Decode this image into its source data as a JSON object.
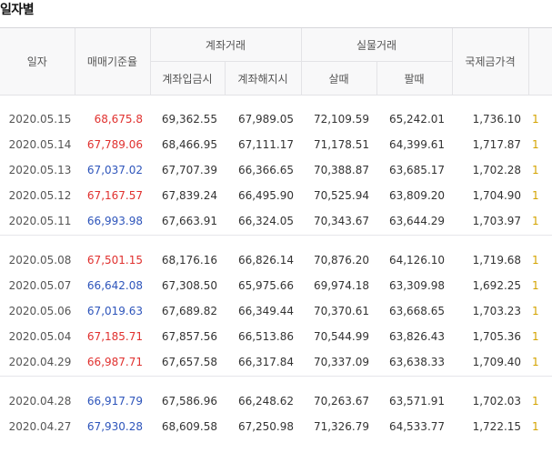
{
  "section": {
    "title": "일자별"
  },
  "header": {
    "date": "일자",
    "base_rate": "매매기준율",
    "account_group": "계좌거래",
    "account_deposit": "계좌입금시",
    "account_withdraw": "계좌해지시",
    "physical_group": "실물거래",
    "physical_buy": "살때",
    "physical_sell": "팔때",
    "intl_price": "국제금가격"
  },
  "colors": {
    "up": "#e0312f",
    "down": "#2e55bb",
    "extra": "#d4a300"
  },
  "groups": [
    {
      "rows": [
        {
          "date": "2020.05.15",
          "base": "68,675.8",
          "trend": "up",
          "deposit": "69,362.55",
          "withdraw": "67,989.05",
          "buy": "72,109.59",
          "sell": "65,242.01",
          "intl": "1,736.10",
          "extra": "1"
        },
        {
          "date": "2020.05.14",
          "base": "67,789.06",
          "trend": "up",
          "deposit": "68,466.95",
          "withdraw": "67,111.17",
          "buy": "71,178.51",
          "sell": "64,399.61",
          "intl": "1,717.87",
          "extra": "1"
        },
        {
          "date": "2020.05.13",
          "base": "67,037.02",
          "trend": "down",
          "deposit": "67,707.39",
          "withdraw": "66,366.65",
          "buy": "70,388.87",
          "sell": "63,685.17",
          "intl": "1,702.28",
          "extra": "1"
        },
        {
          "date": "2020.05.12",
          "base": "67,167.57",
          "trend": "up",
          "deposit": "67,839.24",
          "withdraw": "66,495.90",
          "buy": "70,525.94",
          "sell": "63,809.20",
          "intl": "1,704.90",
          "extra": "1"
        },
        {
          "date": "2020.05.11",
          "base": "66,993.98",
          "trend": "down",
          "deposit": "67,663.91",
          "withdraw": "66,324.05",
          "buy": "70,343.67",
          "sell": "63,644.29",
          "intl": "1,703.97",
          "extra": "1"
        }
      ]
    },
    {
      "rows": [
        {
          "date": "2020.05.08",
          "base": "67,501.15",
          "trend": "up",
          "deposit": "68,176.16",
          "withdraw": "66,826.14",
          "buy": "70,876.20",
          "sell": "64,126.10",
          "intl": "1,719.68",
          "extra": "1"
        },
        {
          "date": "2020.05.07",
          "base": "66,642.08",
          "trend": "down",
          "deposit": "67,308.50",
          "withdraw": "65,975.66",
          "buy": "69,974.18",
          "sell": "63,309.98",
          "intl": "1,692.25",
          "extra": "1"
        },
        {
          "date": "2020.05.06",
          "base": "67,019.63",
          "trend": "down",
          "deposit": "67,689.82",
          "withdraw": "66,349.44",
          "buy": "70,370.61",
          "sell": "63,668.65",
          "intl": "1,703.23",
          "extra": "1"
        },
        {
          "date": "2020.05.04",
          "base": "67,185.71",
          "trend": "up",
          "deposit": "67,857.56",
          "withdraw": "66,513.86",
          "buy": "70,544.99",
          "sell": "63,826.43",
          "intl": "1,705.36",
          "extra": "1"
        },
        {
          "date": "2020.04.29",
          "base": "66,987.71",
          "trend": "up",
          "deposit": "67,657.58",
          "withdraw": "66,317.84",
          "buy": "70,337.09",
          "sell": "63,638.33",
          "intl": "1,709.40",
          "extra": "1"
        }
      ]
    },
    {
      "rows": [
        {
          "date": "2020.04.28",
          "base": "66,917.79",
          "trend": "down",
          "deposit": "67,586.96",
          "withdraw": "66,248.62",
          "buy": "70,263.67",
          "sell": "63,571.91",
          "intl": "1,702.03",
          "extra": "1"
        },
        {
          "date": "2020.04.27",
          "base": "67,930.28",
          "trend": "down",
          "deposit": "68,609.58",
          "withdraw": "67,250.98",
          "buy": "71,326.79",
          "sell": "64,533.77",
          "intl": "1,722.15",
          "extra": "1"
        }
      ]
    }
  ]
}
